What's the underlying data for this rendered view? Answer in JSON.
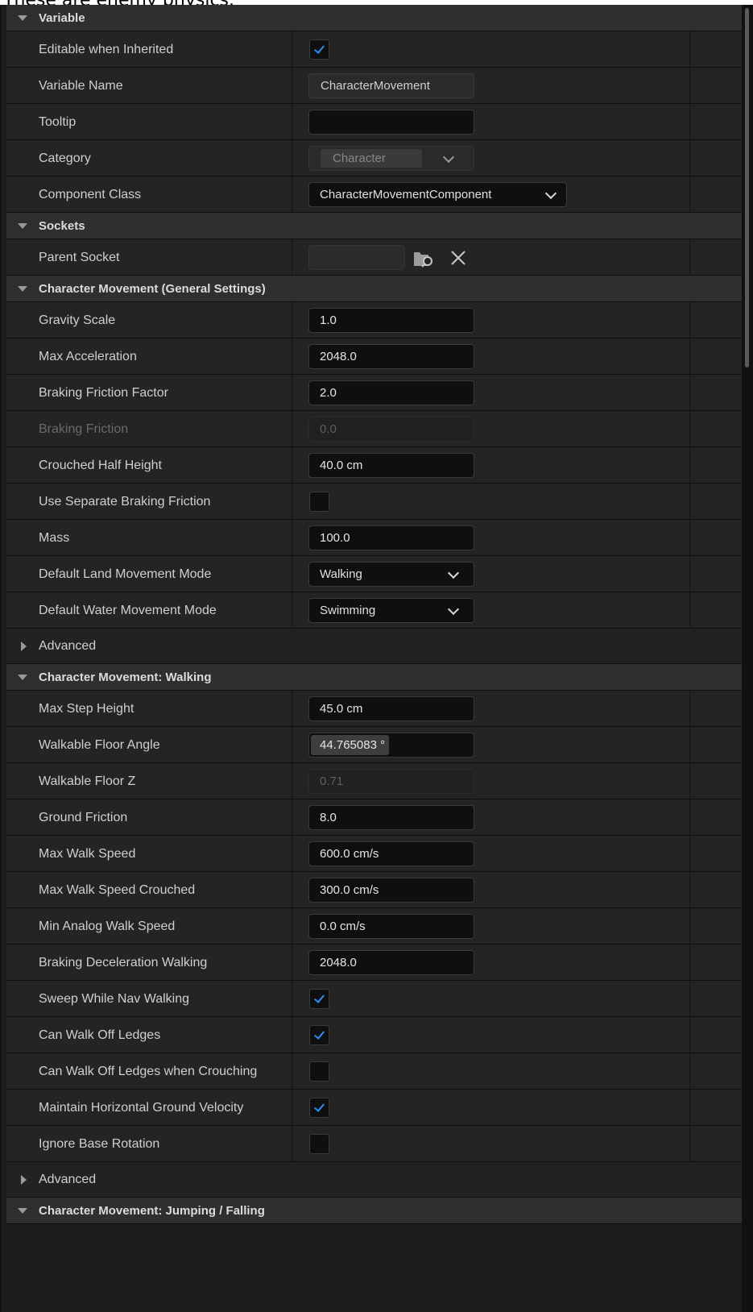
{
  "caption": "These are enemy physics.",
  "sections": {
    "variable": {
      "title": "Variable",
      "editable_when_inherited": "Editable when Inherited",
      "variable_name_label": "Variable Name",
      "variable_name_value": "CharacterMovement",
      "tooltip_label": "Tooltip",
      "tooltip_value": "",
      "category_label": "Category",
      "category_value": "Character",
      "component_class_label": "Component Class",
      "component_class_value": "CharacterMovementComponent"
    },
    "sockets": {
      "title": "Sockets",
      "parent_socket_label": "Parent Socket"
    },
    "general": {
      "title": "Character Movement (General Settings)",
      "gravity_scale_label": "Gravity Scale",
      "gravity_scale_value": "1.0",
      "max_acceleration_label": "Max Acceleration",
      "max_acceleration_value": "2048.0",
      "braking_friction_factor_label": "Braking Friction Factor",
      "braking_friction_factor_value": "2.0",
      "braking_friction_label": "Braking Friction",
      "braking_friction_value": "0.0",
      "crouched_half_height_label": "Crouched Half Height",
      "crouched_half_height_value": "40.0 cm",
      "use_separate_braking_friction_label": "Use Separate Braking Friction",
      "mass_label": "Mass",
      "mass_value": "100.0",
      "default_land_mode_label": "Default Land Movement Mode",
      "default_land_mode_value": "Walking",
      "default_water_mode_label": "Default Water Movement Mode",
      "default_water_mode_value": "Swimming",
      "advanced_label": "Advanced"
    },
    "walking": {
      "title": "Character Movement: Walking",
      "max_step_height_label": "Max Step Height",
      "max_step_height_value": "45.0 cm",
      "walkable_floor_angle_label": "Walkable Floor Angle",
      "walkable_floor_angle_value": "44.765083 °",
      "walkable_floor_z_label": "Walkable Floor Z",
      "walkable_floor_z_value": "0.71",
      "ground_friction_label": "Ground Friction",
      "ground_friction_value": "8.0",
      "max_walk_speed_label": "Max Walk Speed",
      "max_walk_speed_value": "600.0 cm/s",
      "max_walk_speed_crouched_label": "Max Walk Speed Crouched",
      "max_walk_speed_crouched_value": "300.0 cm/s",
      "min_analog_walk_speed_label": "Min Analog Walk Speed",
      "min_analog_walk_speed_value": "0.0 cm/s",
      "braking_decel_walking_label": "Braking Deceleration Walking",
      "braking_decel_walking_value": "2048.0",
      "sweep_while_nav_walking_label": "Sweep While Nav Walking",
      "can_walk_off_ledges_label": "Can Walk Off Ledges",
      "can_walk_off_ledges_crouching_label": "Can Walk Off Ledges when Crouching",
      "maintain_horizontal_ground_velocity_label": "Maintain Horizontal Ground Velocity",
      "ignore_base_rotation_label": "Ignore Base Rotation",
      "advanced_label": "Advanced"
    },
    "jumping": {
      "title": "Character Movement: Jumping / Falling"
    }
  },
  "checkbox_states": {
    "editable_when_inherited": true,
    "use_separate_braking_friction": false,
    "sweep_while_nav_walking": true,
    "can_walk_off_ledges": true,
    "can_walk_off_ledges_crouching": false,
    "maintain_horizontal_ground_velocity": true,
    "ignore_base_rotation": false
  },
  "colors": {
    "panel_bg": "#1c1c1c",
    "header_bg": "#2f2f2f",
    "check_accent": "#2f8ff2"
  },
  "icons": [
    "collapse-arrow-icon",
    "expand-arrow-icon",
    "chevron-down-icon",
    "browse-socket-icon",
    "clear-icon",
    "checkmark-icon"
  ]
}
